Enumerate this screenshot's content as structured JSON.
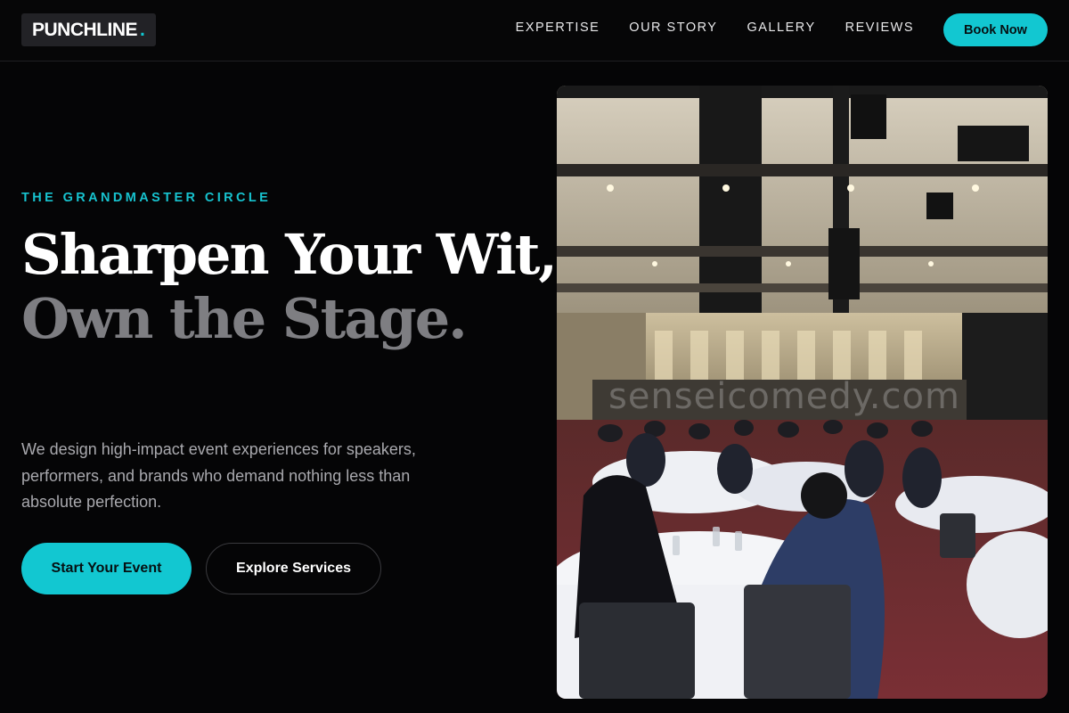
{
  "header": {
    "logo_text": "PUNCHLINE",
    "logo_dot": ".",
    "nav": [
      {
        "label": "EXPERTISE"
      },
      {
        "label": "OUR STORY"
      },
      {
        "label": "GALLERY"
      },
      {
        "label": "REVIEWS"
      }
    ],
    "cta_label": "Book Now"
  },
  "hero": {
    "eyebrow": "THE GRANDMASTER CIRCLE",
    "headline_line1": "Sharpen Your Wit,",
    "headline_line2": "Own the Stage.",
    "description": "We design high-impact event experiences for speakers, performers, and brands who demand nothing less than absolute perfection.",
    "primary_button": "Start Your Event",
    "secondary_button": "Explore Services",
    "image_watermark": "senseicomedy.com"
  },
  "colors": {
    "accent": "#12c7d1",
    "background": "#050506",
    "headline_muted": "#7e7e82",
    "body_text": "#a9a9ae"
  }
}
